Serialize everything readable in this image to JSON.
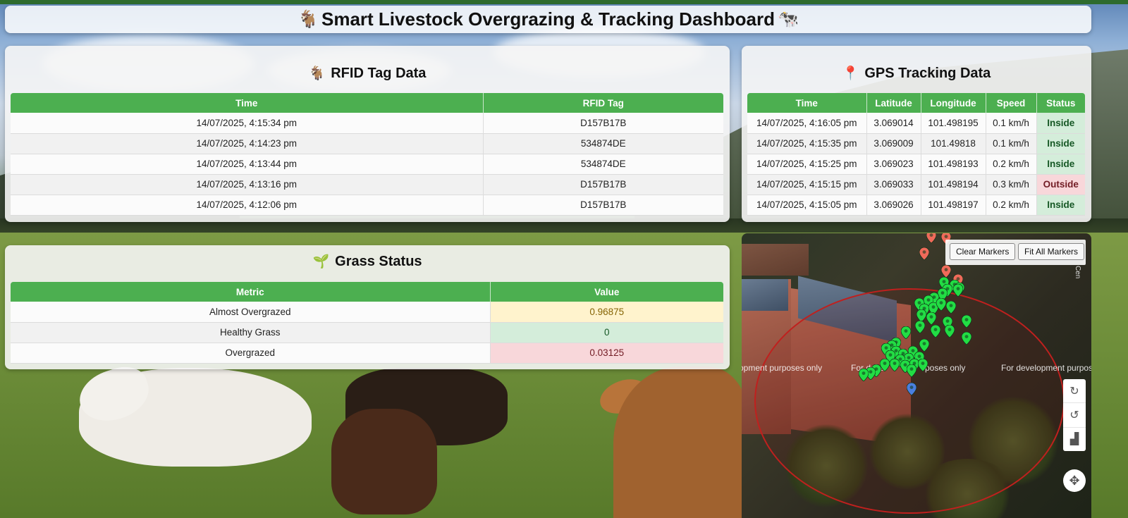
{
  "header": {
    "title": "Smart Livestock Overgrazing & Tracking Dashboard",
    "left_emoji": "🐐",
    "right_emoji": "🐄"
  },
  "rfid": {
    "title": "RFID Tag Data",
    "emoji": "🐐",
    "columns": [
      "Time",
      "RFID Tag"
    ],
    "rows": [
      [
        "14/07/2025, 4:15:34 pm",
        "D157B17B"
      ],
      [
        "14/07/2025, 4:14:23 pm",
        "534874DE"
      ],
      [
        "14/07/2025, 4:13:44 pm",
        "534874DE"
      ],
      [
        "14/07/2025, 4:13:16 pm",
        "D157B17B"
      ],
      [
        "14/07/2025, 4:12:06 pm",
        "D157B17B"
      ]
    ]
  },
  "gps": {
    "title": "GPS Tracking Data",
    "emoji": "📍",
    "columns": [
      "Time",
      "Latitude",
      "Longitude",
      "Speed",
      "Status"
    ],
    "rows": [
      [
        "14/07/2025, 4:16:05 pm",
        "3.069014",
        "101.498195",
        "0.1 km/h",
        "Inside"
      ],
      [
        "14/07/2025, 4:15:35 pm",
        "3.069009",
        "101.49818",
        "0.1 km/h",
        "Inside"
      ],
      [
        "14/07/2025, 4:15:25 pm",
        "3.069023",
        "101.498193",
        "0.2 km/h",
        "Inside"
      ],
      [
        "14/07/2025, 4:15:15 pm",
        "3.069033",
        "101.498194",
        "0.3 km/h",
        "Outside"
      ],
      [
        "14/07/2025, 4:15:05 pm",
        "3.069026",
        "101.498197",
        "0.2 km/h",
        "Inside"
      ]
    ]
  },
  "grass": {
    "title": "Grass Status",
    "emoji": "🌱",
    "columns": [
      "Metric",
      "Value"
    ],
    "rows": [
      [
        "Almost Overgrazed",
        "0.96875",
        "warn"
      ],
      [
        "Healthy Grass",
        "0",
        "ok"
      ],
      [
        "Overgrazed",
        "0.03125",
        "bad"
      ]
    ]
  },
  "map": {
    "clear_label": "Clear Markers",
    "fit_label": "Fit All Markers",
    "watermark": "For development purposes only",
    "watermark_partial_left": "opment purposes only",
    "watermark_partial_mid": "For devel",
    "watermark_partial_mid2": "poses only",
    "watermark_partial_right": "For development purpose",
    "edge_label": "Cen",
    "colors": {
      "inside_marker": "#22dd44",
      "outside_marker": "#f06a5a",
      "current_marker": "#4a7fe0",
      "geofence": "#c0201e"
    }
  }
}
